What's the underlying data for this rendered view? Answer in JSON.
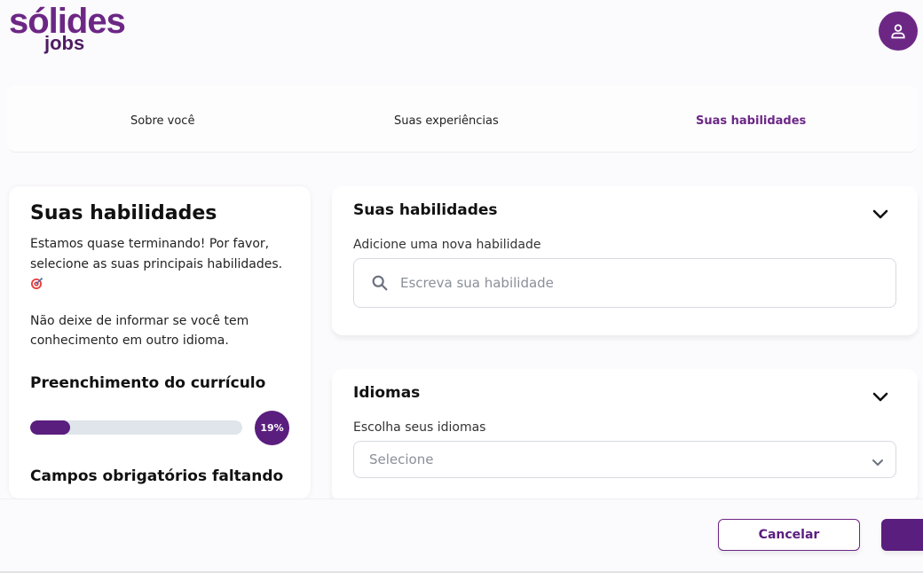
{
  "logo": {
    "brand": "sólides",
    "sub": "jobs"
  },
  "steps": [
    {
      "label": "Sobre você",
      "active": false
    },
    {
      "label": "Suas experiências",
      "active": false
    },
    {
      "label": "Suas habilidades",
      "active": true
    }
  ],
  "sidebar": {
    "title": "Suas habilidades",
    "paragraph1": "Estamos quase terminando! Por favor, selecione as suas principais habilidades.",
    "paragraph2": "Não deixe de informar se você tem conhecimento em outro idioma.",
    "progress_title": "Preenchimento do currículo",
    "progress_percent": 19,
    "progress_label": "19%",
    "missing_title": "Campos obrigatórios faltando"
  },
  "skills_card": {
    "title": "Suas habilidades",
    "label": "Adicione uma nova habilidade",
    "placeholder": "Escreva sua habilidade"
  },
  "languages_card": {
    "title": "Idiomas",
    "label": "Escolha seus idiomas",
    "select_value": "Selecione"
  },
  "footer": {
    "cancel_label": "Cancelar"
  },
  "colors": {
    "brand": "#6c2785",
    "brand_dark": "#5a1e7e",
    "progress_track": "#dfe5ea"
  }
}
